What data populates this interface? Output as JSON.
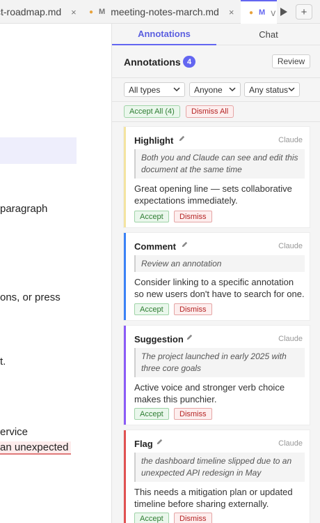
{
  "tabs": [
    {
      "label": "ct-roadmap.md",
      "close": "×"
    },
    {
      "badge": "M",
      "label": "meeting-notes-march.md",
      "close": "×"
    },
    {
      "badge": "M",
      "label": "v"
    }
  ],
  "new_tab_label": "+",
  "editor": {
    "lines": [
      "paragraph",
      "ons, or press",
      "t.",
      "ervice",
      "an unexpected"
    ]
  },
  "panel": {
    "tabs": {
      "annotations": "Annotations",
      "chat": "Chat"
    },
    "title": "Annotations",
    "count": "4",
    "review_label": "Review",
    "filters": {
      "type": "All types",
      "person": "Anyone",
      "status": "Any status"
    },
    "accept_all": "Accept All (4)",
    "dismiss_all": "Dismiss All"
  },
  "cards": [
    {
      "type": "Highlight",
      "author": "Claude",
      "quote": "Both you and Claude can see and edit this document at the same time",
      "body": "Great opening line — sets collaborative expectations immediately.",
      "accept": "Accept",
      "dismiss": "Dismiss",
      "color": "#f4e4a1"
    },
    {
      "type": "Comment",
      "author": "Claude",
      "quote": "Review an annotation",
      "body": "Consider linking to a specific annotation so new users don't have to search for one.",
      "accept": "Accept",
      "dismiss": "Dismiss",
      "color": "#3b82f6"
    },
    {
      "type": "Suggestion",
      "author": "Claude",
      "quote": "The project launched in early 2025 with three core goals",
      "body": "Active voice and stronger verb choice makes this punchier.",
      "accept": "Accept",
      "dismiss": "Dismiss",
      "color": "#8b5cf6"
    },
    {
      "type": "Flag",
      "author": "Claude",
      "quote": "the dashboard timeline slipped due to an unexpected API redesign in May",
      "body": "This needs a mitigation plan or updated timeline before sharing externally.",
      "accept": "Accept",
      "dismiss": "Dismiss",
      "color": "#e05252"
    }
  ],
  "colors": {
    "accent": "#6366f1",
    "modified_dot": "#e8a33c"
  }
}
